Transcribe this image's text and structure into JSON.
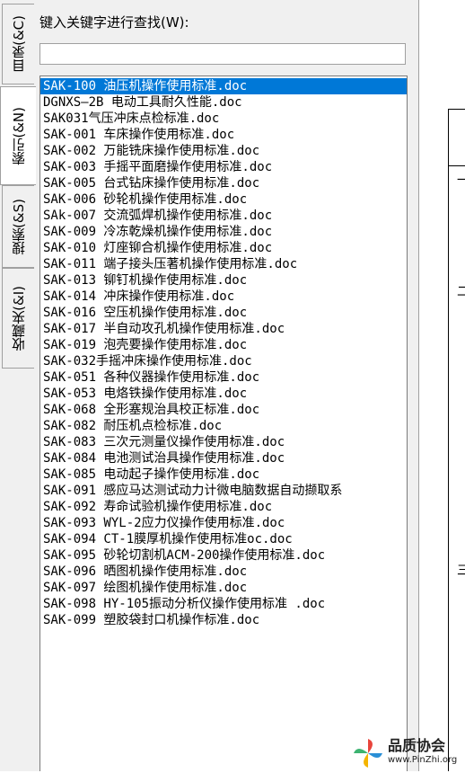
{
  "tabs": [
    {
      "label": "目录(&C)"
    },
    {
      "label": "索引(&N)"
    },
    {
      "label": "搜索(&S)"
    },
    {
      "label": "收藏夹(&I)"
    }
  ],
  "search": {
    "label": "键入关键字进行查找(W):",
    "value": ""
  },
  "list": {
    "selected_index": 0,
    "items": [
      "SAK-100 油压机操作使用标准.doc",
      "DGNXS—2B 电动工具耐久性能.doc",
      "SAK031气压冲床点检标准.doc",
      "SAK-001 车床操作使用标准.doc",
      "SAK-002 万能铣床操作使用标准.doc",
      "SAK-003 手摇平面磨操作使用标准.doc",
      "SAK-005 台式钻床操作使用标准.doc",
      "SAK-006 砂轮机操作使用标准.doc",
      "SAk-007 交流弧焊机操作使用标准.doc",
      "SAK-009 冷冻乾燥机操作使用标准.doc",
      "SAK-010 灯座铆合机操作使用标准.doc",
      "SAK-011 端子接头压著机操作使用标准.doc",
      "SAK-013 铆钉机操作使用标准.doc",
      "SAK-014 冲床操作使用标准.doc",
      "SAK-016 空压机操作使用标准.doc",
      "SAK-017 半自动攻孔机操作使用标准.doc",
      "SAK-019 泡壳要操作使用标准.doc",
      "SAK-032手摇冲床操作使用标准.doc",
      "SAK-051 各种仪器操作使用标准.doc",
      "SAK-053 电烙铁操作使用标准.doc",
      "SAK-068 全形塞规治具校正标准.doc",
      "SAK-082 耐压机点检标准.doc",
      "SAK-083 三次元测量仪操作使用标准.doc",
      "SAK-084 电池测试治具操作使用标准.doc",
      "SAK-085 电动起子操作使用标准.doc",
      "SAK-091 感应马达测试动力计微电脑数据自动撷取系",
      "SAK-092 寿命试验机操作使用标准.doc",
      "SAK-093 WYL-2应力仪操作使用标准.doc",
      "SAK-094 CT-1膜厚机操作使用标准oc.doc",
      "SAK-095 砂轮切割机ACM-200操作使用标准.doc",
      "SAK-096 晒图机操作使用标准.doc",
      "SAK-097 绘图机操作使用标准.doc",
      "SAK-098 HY-105振动分析仪操作使用标准 .doc",
      "SAK-099 塑胶袋封口机操作标准.doc"
    ]
  },
  "doc_marks": [
    "一",
    "二",
    "三"
  ],
  "watermark": {
    "title": "品质协会",
    "url": "www.PinZhi.org"
  },
  "colors": {
    "selection": "#0078d7",
    "panel_bg": "#f0f0f0"
  }
}
